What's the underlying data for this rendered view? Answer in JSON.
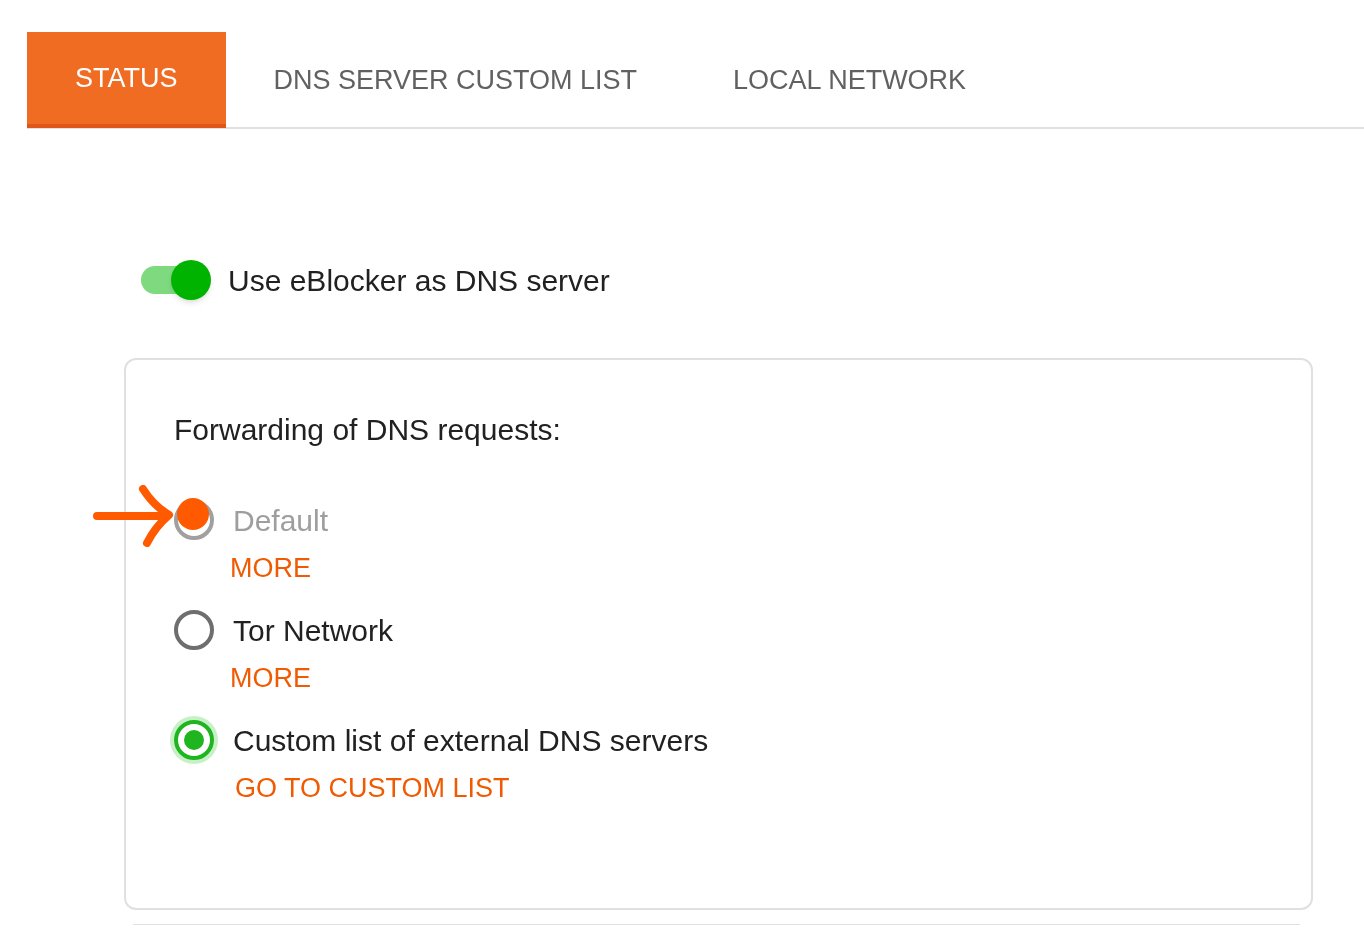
{
  "tabs": [
    {
      "label": "STATUS",
      "selected": true
    },
    {
      "label": "DNS SERVER CUSTOM LIST",
      "selected": false
    },
    {
      "label": "LOCAL NETWORK",
      "selected": false
    }
  ],
  "dns_toggle": {
    "label": "Use eBlocker as DNS server",
    "on": true
  },
  "forwarding": {
    "title": "Forwarding of DNS requests:",
    "options": [
      {
        "label": "Default",
        "selected": false,
        "disabled": true,
        "link": "MORE"
      },
      {
        "label": "Tor Network",
        "selected": false,
        "disabled": false,
        "link": "MORE"
      },
      {
        "label": "Custom list of external DNS servers",
        "selected": true,
        "disabled": false,
        "link": "GO TO CUSTOM LIST"
      }
    ]
  }
}
